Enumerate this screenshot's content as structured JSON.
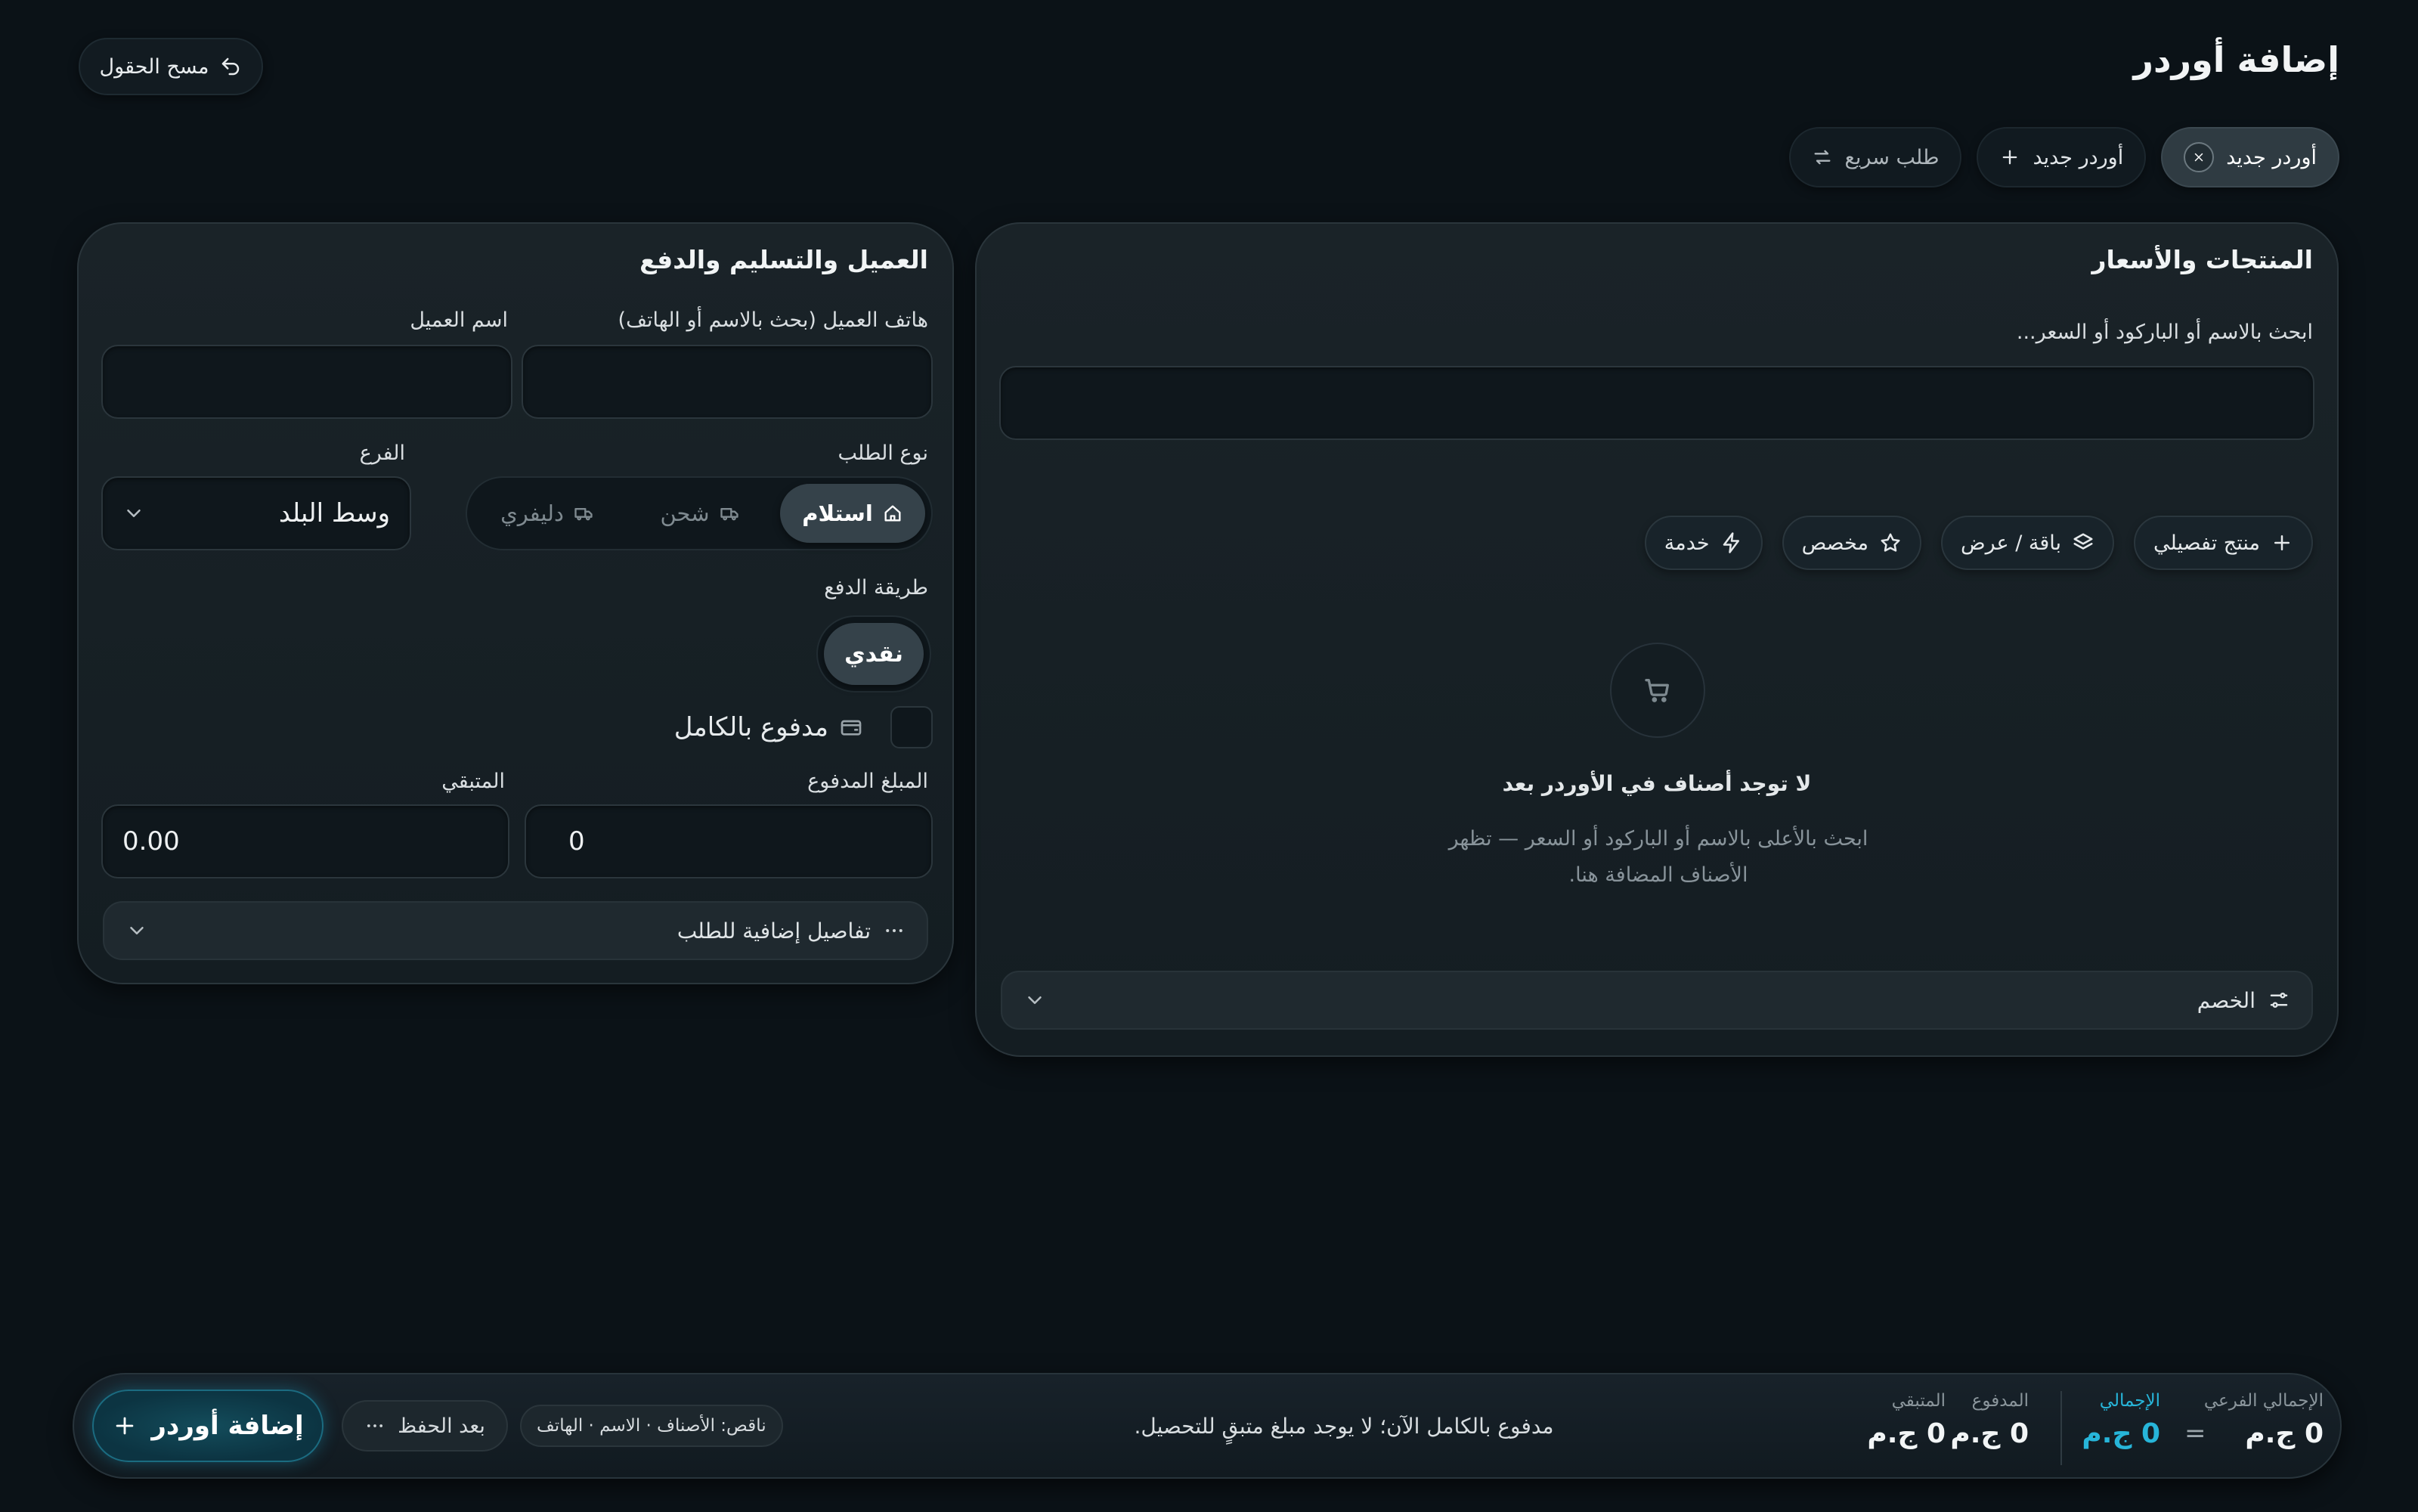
{
  "header": {
    "title": "إضافة أوردر",
    "clear_label": "مسح الحقول"
  },
  "tabs": [
    {
      "label": "أوردر جديد",
      "active": true,
      "icon": "close-icon"
    },
    {
      "label": "أوردر جديد",
      "active": false,
      "icon": "plus-icon"
    },
    {
      "label": "طلب سريع",
      "active": false,
      "icon": "swap-icon"
    }
  ],
  "products": {
    "title": "المنتجات والأسعار",
    "search_label": "ابحث بالاسم أو الباركود أو السعر...",
    "search_value": "",
    "chips": [
      {
        "label": "منتج تفصيلي",
        "icon": "plus-icon"
      },
      {
        "label": "باقة / عرض",
        "icon": "layers-icon"
      },
      {
        "label": "مخصص",
        "icon": "star-icon"
      },
      {
        "label": "خدمة",
        "icon": "bolt-icon"
      }
    ],
    "empty_title": "لا توجد أصناف في الأوردر بعد",
    "empty_desc": "ابحث بالأعلى بالاسم أو الباركود أو السعر — تظهر الأصناف المضافة هنا.",
    "discount_label": "الخصم"
  },
  "customer": {
    "title": "العميل والتسليم والدفع",
    "phone_label": "هاتف العميل (بحث بالاسم أو الهاتف)",
    "phone_value": "",
    "name_label": "اسم العميل",
    "name_value": "",
    "order_type_label": "نوع الطلب",
    "order_types": [
      {
        "label": "استلام",
        "active": true,
        "icon": "home-icon"
      },
      {
        "label": "شحن",
        "active": false,
        "icon": "truck-icon"
      },
      {
        "label": "دليفري",
        "active": false,
        "icon": "truck-icon"
      }
    ],
    "branch_label": "الفرع",
    "branch_value": "وسط البلد",
    "payment_label": "طريقة الدفع",
    "payment_method": "نقدي",
    "paid_full_label": "مدفوع بالكامل",
    "paid_full_checked": false,
    "paid_amount_label": "المبلغ المدفوع",
    "paid_amount_value": "0",
    "remaining_label": "المتبقي",
    "remaining_value": "0.00",
    "extra_details_label": "تفاصيل إضافية للطلب"
  },
  "footer": {
    "subtotal_label": "الإجمالي الفرعي",
    "subtotal_value": "0 ج.م",
    "equals": "=",
    "total_label": "الإجمالي",
    "total_value": "0 ج.م",
    "paid_label": "المدفوع",
    "paid_value": "0 ج.م",
    "remaining_label": "المتبقي",
    "remaining_value": "0 ج.م",
    "status_message": "مدفوع بالكامل الآن؛ لا يوجد مبلغ متبقٍ للتحصيل.",
    "missing_badge": "ناقص: الأصناف · الاسم · الهاتف",
    "unsaved_label": "بعد الحفظ",
    "add_order_label": "إضافة أوردر",
    "accent_color": "#27b5d9"
  }
}
